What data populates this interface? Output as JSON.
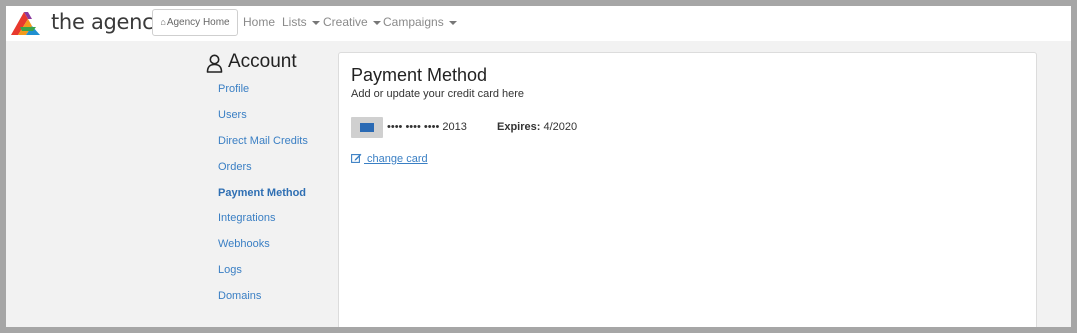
{
  "brand": {
    "name": "the agency"
  },
  "navbar": {
    "agency_home_label": "Agency Home",
    "items": [
      {
        "label": "Home",
        "has_dropdown": false
      },
      {
        "label": "Lists",
        "has_dropdown": true
      },
      {
        "label": "Creative",
        "has_dropdown": true
      },
      {
        "label": "Campaigns",
        "has_dropdown": true
      }
    ]
  },
  "sidebar": {
    "title": "Account",
    "title_icon": "user-icon",
    "items": [
      {
        "label": "Profile",
        "active": false
      },
      {
        "label": "Users",
        "active": false
      },
      {
        "label": "Direct Mail Credits",
        "active": false
      },
      {
        "label": "Orders",
        "active": false
      },
      {
        "label": "Payment Method",
        "active": true
      },
      {
        "label": "Integrations",
        "active": false
      },
      {
        "label": "Webhooks",
        "active": false
      },
      {
        "label": "Logs",
        "active": false
      },
      {
        "label": "Domains",
        "active": false
      }
    ]
  },
  "panel": {
    "title": "Payment Method",
    "subtitle": "Add or update your credit card here",
    "card": {
      "brand_icon": "amex-card-icon",
      "number_masked": "•••• •••• •••• 2013",
      "expires_label": "Expires:",
      "expires_value": "4/2020"
    },
    "change_card_label": " change card"
  },
  "colors": {
    "link": "#3a7fc4",
    "active_link": "#2f6fb3",
    "page_bg": "#f2f2f2",
    "frame_border": "#a6a6a6"
  }
}
